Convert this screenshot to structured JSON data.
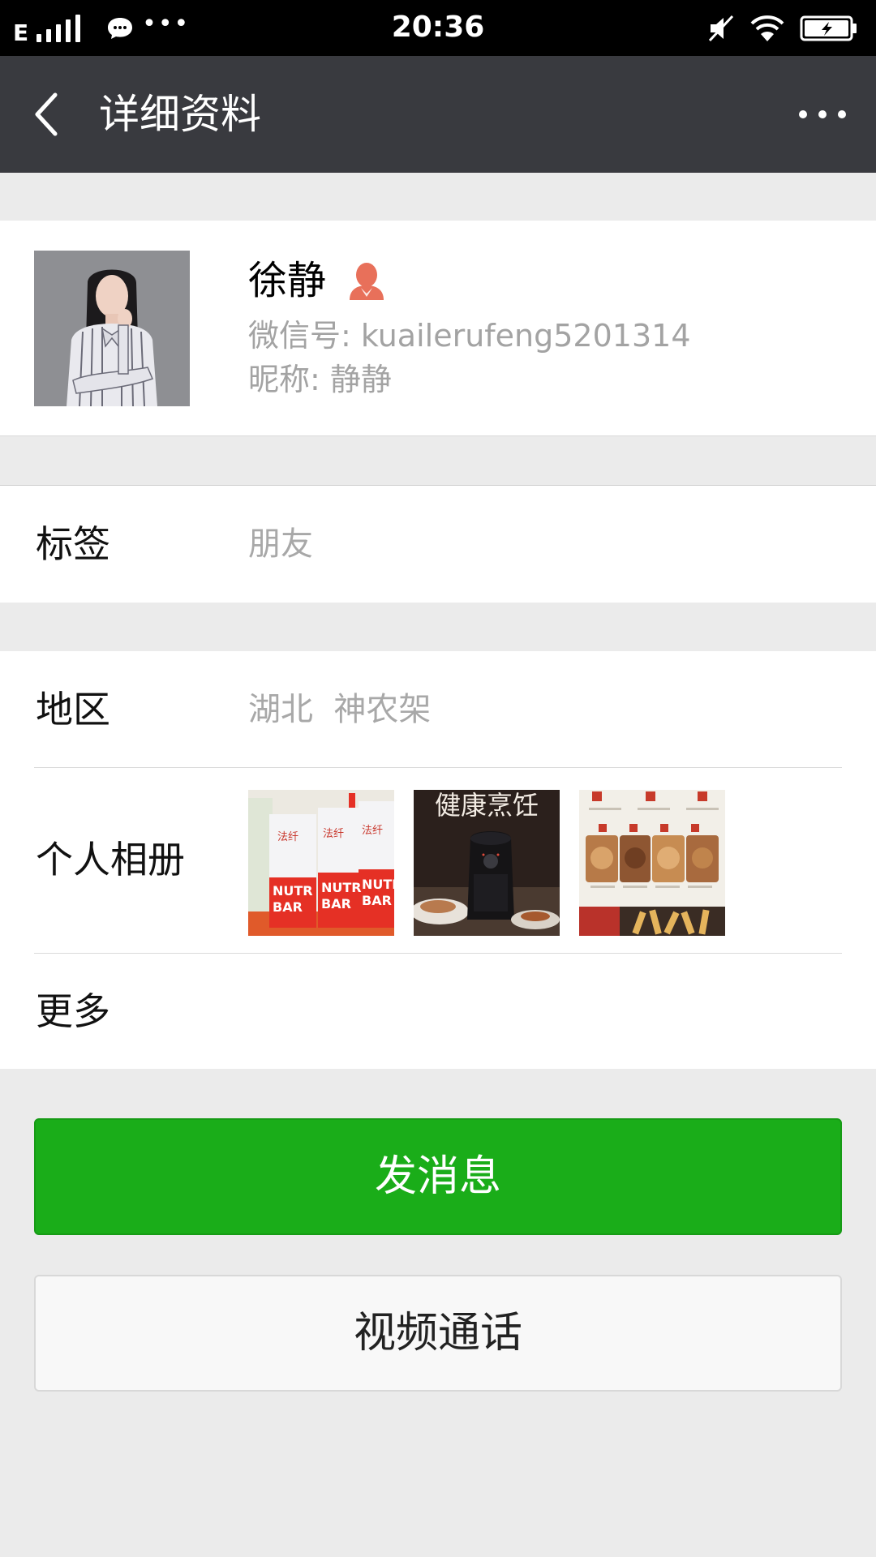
{
  "status_bar": {
    "network_type": "E",
    "time": "20:36",
    "notification_more": "•••"
  },
  "header": {
    "title": "详细资料"
  },
  "profile": {
    "name": "徐静",
    "wechat_id_line": "微信号: kuailerufeng5201314",
    "nickname_line": "昵称: 静静"
  },
  "tags": {
    "label": "标签",
    "value": "朋友"
  },
  "region": {
    "label": "地区",
    "value": "湖北  神农架"
  },
  "album": {
    "label": "个人相册",
    "thumb1_brand": "法纤",
    "thumb1_product": "NUTRI BAR",
    "thumb2_text": "健康烹饪"
  },
  "more": {
    "label": "更多"
  },
  "buttons": {
    "send_message": "发消息",
    "video_call": "视频通话"
  },
  "colors": {
    "status_bar_bg": "#000000",
    "header_bg": "#393a3f",
    "page_bg": "#ebebeb",
    "primary_button": "#1aad19",
    "secondary_button": "#f8f8f8",
    "gender_icon": "#e8705a",
    "secondary_text": "#a3a3a3"
  },
  "icons": {
    "back": "chevron-left-icon",
    "more": "more-horizontal-icon",
    "gender": "female-user-icon",
    "wifi": "wifi-icon",
    "battery": "battery-charging-icon",
    "mute": "mute-icon",
    "chat_notification": "chat-bubble-icon"
  }
}
